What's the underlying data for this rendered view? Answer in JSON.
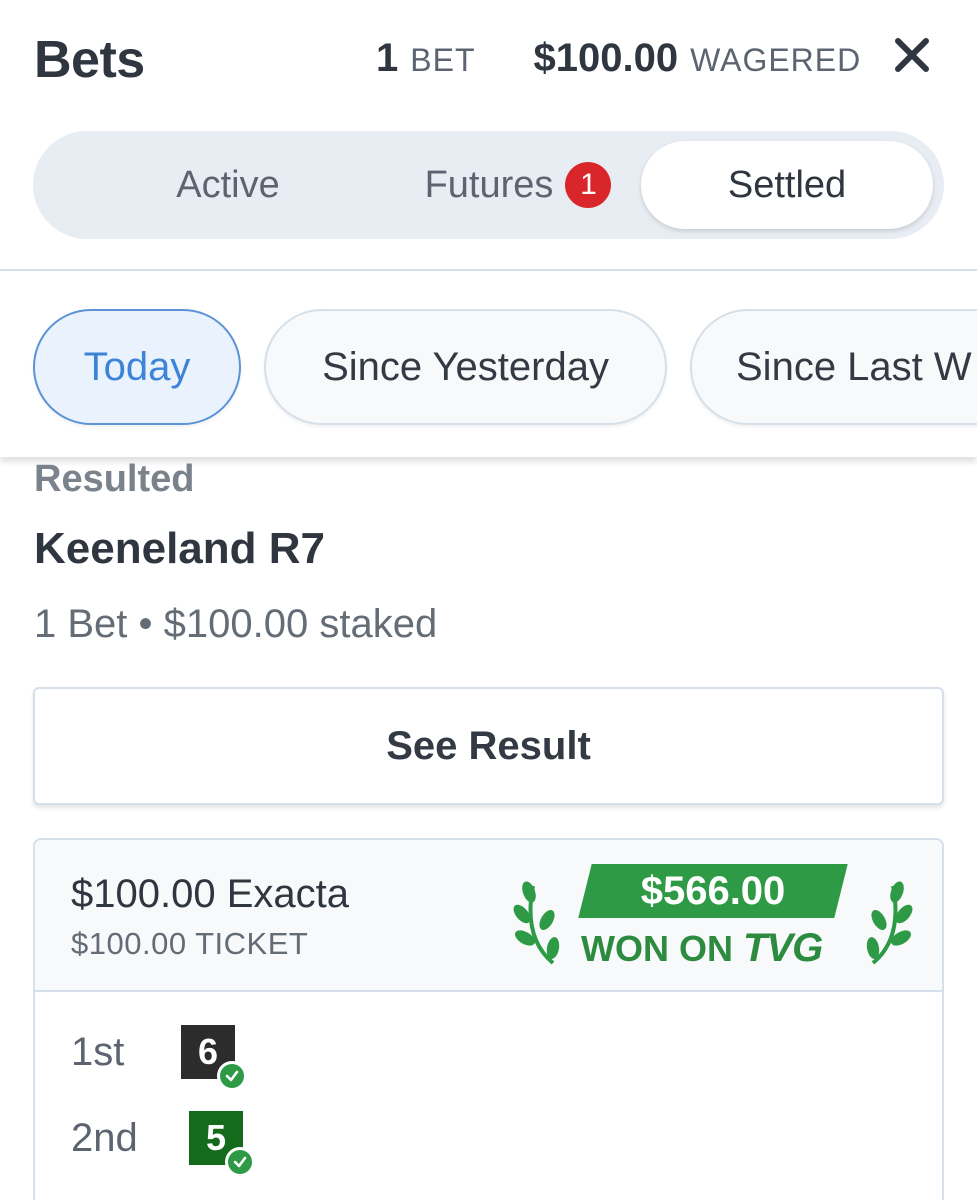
{
  "header": {
    "title": "Bets",
    "bet_count": "1",
    "bet_unit": "BET",
    "wagered_amount": "$100.00",
    "wagered_unit": "WAGERED",
    "close_icon": "close-icon"
  },
  "tabs": [
    {
      "label": "Active",
      "selected": false
    },
    {
      "label": "Futures",
      "badge": "1",
      "selected": false
    },
    {
      "label": "Settled",
      "selected": true
    }
  ],
  "filters": [
    {
      "label": "Today",
      "selected": true
    },
    {
      "label": "Since Yesterday",
      "selected": false
    },
    {
      "label": "Since Last W",
      "selected": false
    }
  ],
  "section": {
    "status": "Resulted",
    "track": "Keeneland R7",
    "summary": "1 Bet • $100.00 staked"
  },
  "see_result_label": "See Result",
  "bet": {
    "type": "$100.00 Exacta",
    "ticket": "$100.00 TICKET",
    "won_amount": "$566.00",
    "won_on_text": "WON ON",
    "won_on_brand": "TVG",
    "positions": [
      {
        "label": "1st",
        "runner": "6"
      },
      {
        "label": "2nd",
        "runner": "5"
      }
    ]
  },
  "colors": {
    "accent_blue": "#3d84d6",
    "badge_red": "#d9262b",
    "win_green": "#2e9a45",
    "runner_6_bg": "#2c2c2c",
    "runner_5_bg": "#146b1b"
  }
}
